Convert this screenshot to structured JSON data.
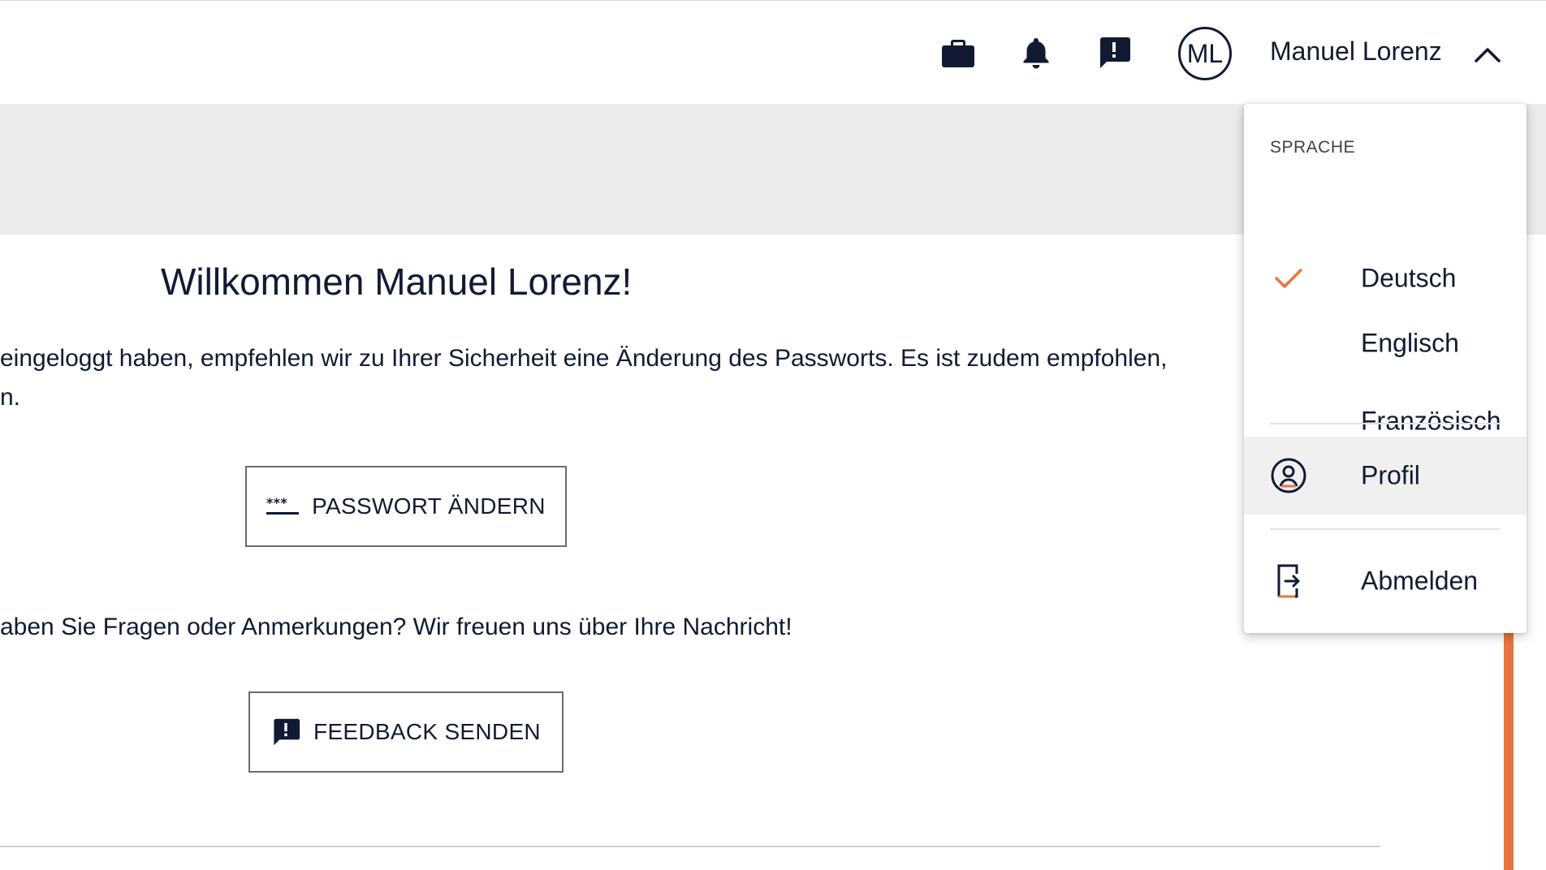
{
  "colors": {
    "text": "#121a33",
    "accent": "#e8743f",
    "grey_band": "#ebebeb",
    "menu_hover": "#f0f0f0"
  },
  "header": {
    "icons": [
      "briefcase-icon",
      "bell-icon",
      "feedback-icon"
    ],
    "avatar_initials": "ML",
    "user_name": "Manuel Lorenz",
    "menu_toggle_icon": "chevron-up-icon"
  },
  "main": {
    "welcome_title": "Willkommen Manuel Lorenz!",
    "intro_line_1": "eingeloggt haben, empfehlen wir zu Ihrer Sicherheit eine Änderung des Passworts. Es ist zudem empfohlen,",
    "intro_line_2": "n.",
    "change_password_label": "PASSWORT ÄNDERN",
    "feedback_prompt": "aben Sie Fragen oder Anmerkungen? Wir freuen uns über Ihre Nachricht!",
    "send_feedback_label": "FEEDBACK SENDEN"
  },
  "user_menu": {
    "language_section_title": "SPRACHE",
    "languages": [
      {
        "label": "Deutsch",
        "selected": true
      },
      {
        "label": "Englisch",
        "selected": false
      },
      {
        "label": "Französisch",
        "selected": false
      }
    ],
    "profile_label": "Profil",
    "logout_label": "Abmelden"
  }
}
